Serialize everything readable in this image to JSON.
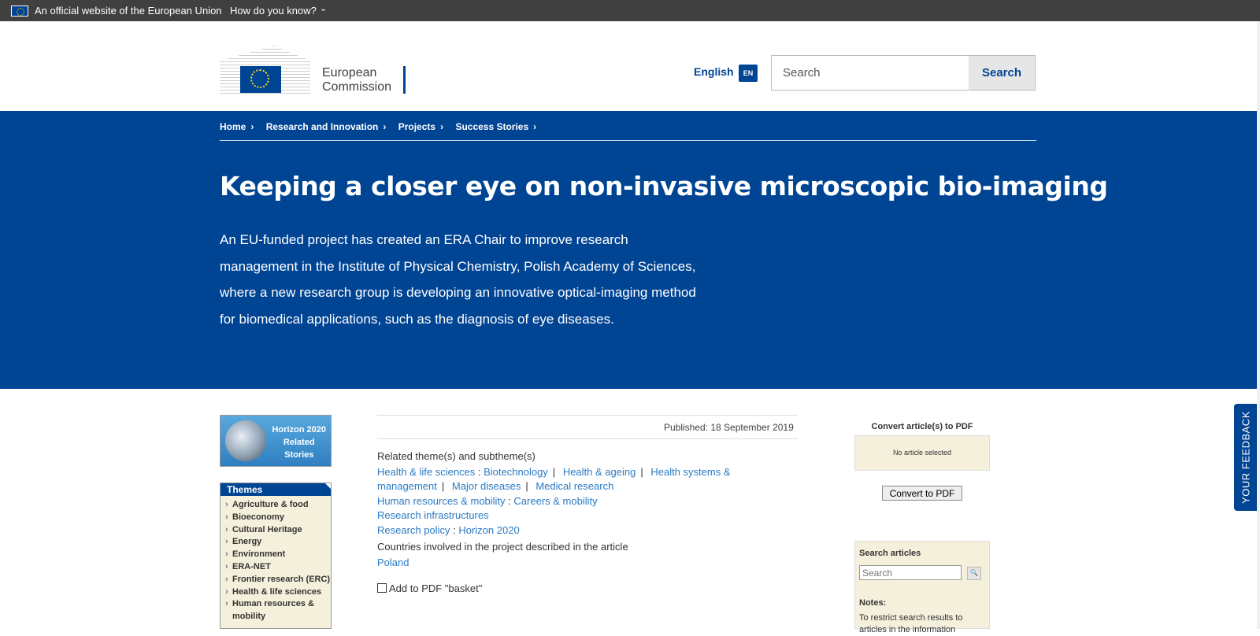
{
  "eu_bar": {
    "official_text": "An official website of the European Union",
    "how_text": "How do you know?"
  },
  "header": {
    "logo_line1": "European",
    "logo_line2": "Commission",
    "language": "English",
    "language_code": "EN",
    "search_placeholder": "Search",
    "search_button": "Search"
  },
  "breadcrumb": [
    {
      "label": "Home"
    },
    {
      "label": "Research and Innovation"
    },
    {
      "label": "Projects"
    },
    {
      "label": "Success Stories"
    }
  ],
  "article": {
    "title": "Keeping a closer eye on non-invasive microscopic bio-imaging",
    "intro": "An EU-funded project has created an ERA Chair to improve research management in the Institute of Physical Chemistry, Polish Academy of Sciences, where a new research group is developing an innovative optical-imaging method for biomedical applications, such as the diagnosis of eye diseases.",
    "published": "Published: 18 September 2019",
    "related_heading": "Related theme(s) and subtheme(s)",
    "countries_heading": "Countries involved in the project described in the article",
    "country": "Poland",
    "add_pdf": "Add to PDF \"basket\""
  },
  "related_themes": {
    "health": "Health & life sciences",
    "biotech": "Biotechnology",
    "ageing": "Health & ageing",
    "systems": "Health systems & management",
    "diseases": "Major diseases",
    "medical": "Medical research",
    "hr": "Human resources & mobility",
    "careers": "Careers & mobility",
    "infra": "Research infrastructures",
    "policy": "Research policy",
    "h2020": "Horizon 2020"
  },
  "sidebar": {
    "banner_line1": "Horizon 2020",
    "banner_line2": "Related",
    "banner_line3": "Stories",
    "themes_title": "Themes",
    "themes": [
      "Agriculture & food",
      "Bioeconomy",
      "Cultural Heritage",
      "Energy",
      "Environment",
      "ERA-NET",
      "Frontier research (ERC)",
      "Health & life sciences",
      "Human resources & mobility"
    ]
  },
  "right_panel": {
    "convert_heading": "Convert article(s) to PDF",
    "no_article": "No article selected",
    "convert_button": "Convert to PDF",
    "search_heading": "Search articles",
    "search_placeholder": "Search",
    "notes_label": "Notes:",
    "notes_text": "To restrict search results to articles in the information"
  },
  "feedback": {
    "label": "YOUR FEEDBACK"
  },
  "colors": {
    "brand_blue": "#004494",
    "link_blue": "#2a7ac4",
    "eu_bar": "#404040",
    "panel_beige": "#f4f0db"
  }
}
